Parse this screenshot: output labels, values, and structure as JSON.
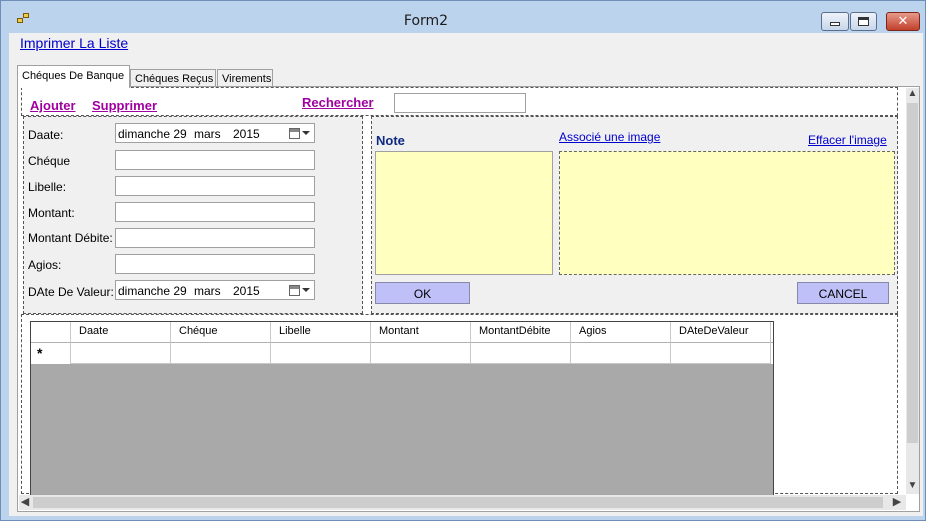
{
  "window": {
    "title": "Form2"
  },
  "menu": {
    "print_link": "Imprimer La Liste"
  },
  "tabs": [
    {
      "label": "Chéques De Banque",
      "active": true
    },
    {
      "label": "Chéques Reçus",
      "active": false
    },
    {
      "label": "Virements",
      "active": false
    }
  ],
  "actions": {
    "add": "Ajouter",
    "delete": "Supprimer",
    "search": "Rechercher",
    "search_value": ""
  },
  "form": {
    "date_label": "Daate:",
    "date_value": {
      "day": "dimanche 29",
      "month": "mars",
      "year": "2015"
    },
    "cheque_label": "Chéque",
    "libelle_label": "Libelle:",
    "montant_label": "Montant:",
    "montant_debite_label": "Montant Débite:",
    "agios_label": "Agios:",
    "date_valeur_label": "DAte De Valeur:",
    "date_valeur_value": {
      "day": "dimanche 29",
      "month": "mars",
      "year": "2015"
    }
  },
  "note": {
    "label": "Note",
    "assoc_link": "Associé une image",
    "clear_link": "Effacer l'image",
    "ok": "OK",
    "cancel": "CANCEL"
  },
  "grid": {
    "columns": [
      "Daate",
      "Chéque",
      "Libelle",
      "Montant",
      "MontantDébite",
      "Agios",
      "DAteDeValeur"
    ],
    "new_row_marker": "*"
  },
  "colors": {
    "note_bg": "#ffffc0",
    "button_bg": "#c0c0f8",
    "action_link": "#a000a0",
    "link": "#0000cc"
  }
}
